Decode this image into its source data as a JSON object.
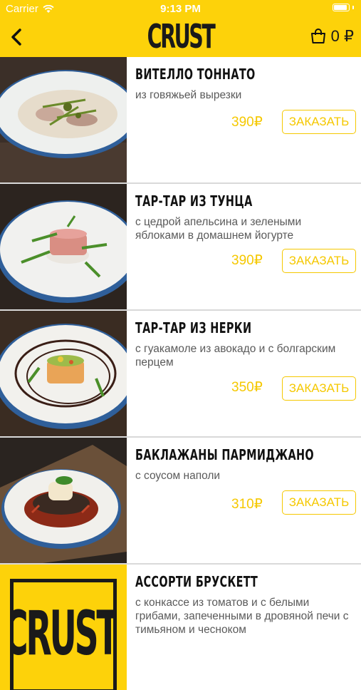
{
  "status_bar": {
    "carrier": "Carrier",
    "time": "9:13 PM"
  },
  "header": {
    "logo": "CRUST",
    "cart_amount": "0 ₽"
  },
  "colors": {
    "accent": "#fdd20a",
    "price": "#f5c800",
    "divider": "#d9d9d9"
  },
  "items": [
    {
      "name": "ВИТЕЛЛО ТОННАТО",
      "description": "из говяжьей вырезки",
      "price": "390₽",
      "button": "ЗАКАЗАТЬ"
    },
    {
      "name": "ТАР-ТАР ИЗ ТУНЦА",
      "description": "с цедрой апельсина и зелеными яблоками в домашнем йогурте",
      "price": "390₽",
      "button": "ЗАКАЗАТЬ"
    },
    {
      "name": "ТАР-ТАР ИЗ НЕРКИ",
      "description": "с гуакамоле из авокадо и с болгарским перцем",
      "price": "350₽",
      "button": "ЗАКАЗАТЬ"
    },
    {
      "name": "БАКЛАЖАНЫ ПАРМИДЖАНО",
      "description": "с соусом наполи",
      "price": "310₽",
      "button": "ЗАКАЗАТЬ"
    },
    {
      "name": "АССОРТИ БРУСКЕТТ",
      "description": "с конкассе из томатов и с белыми грибами, запеченными в дровяной печи с тимьяном и чесноком",
      "price": "",
      "button": ""
    }
  ],
  "placeholder_logo": "CRUST"
}
